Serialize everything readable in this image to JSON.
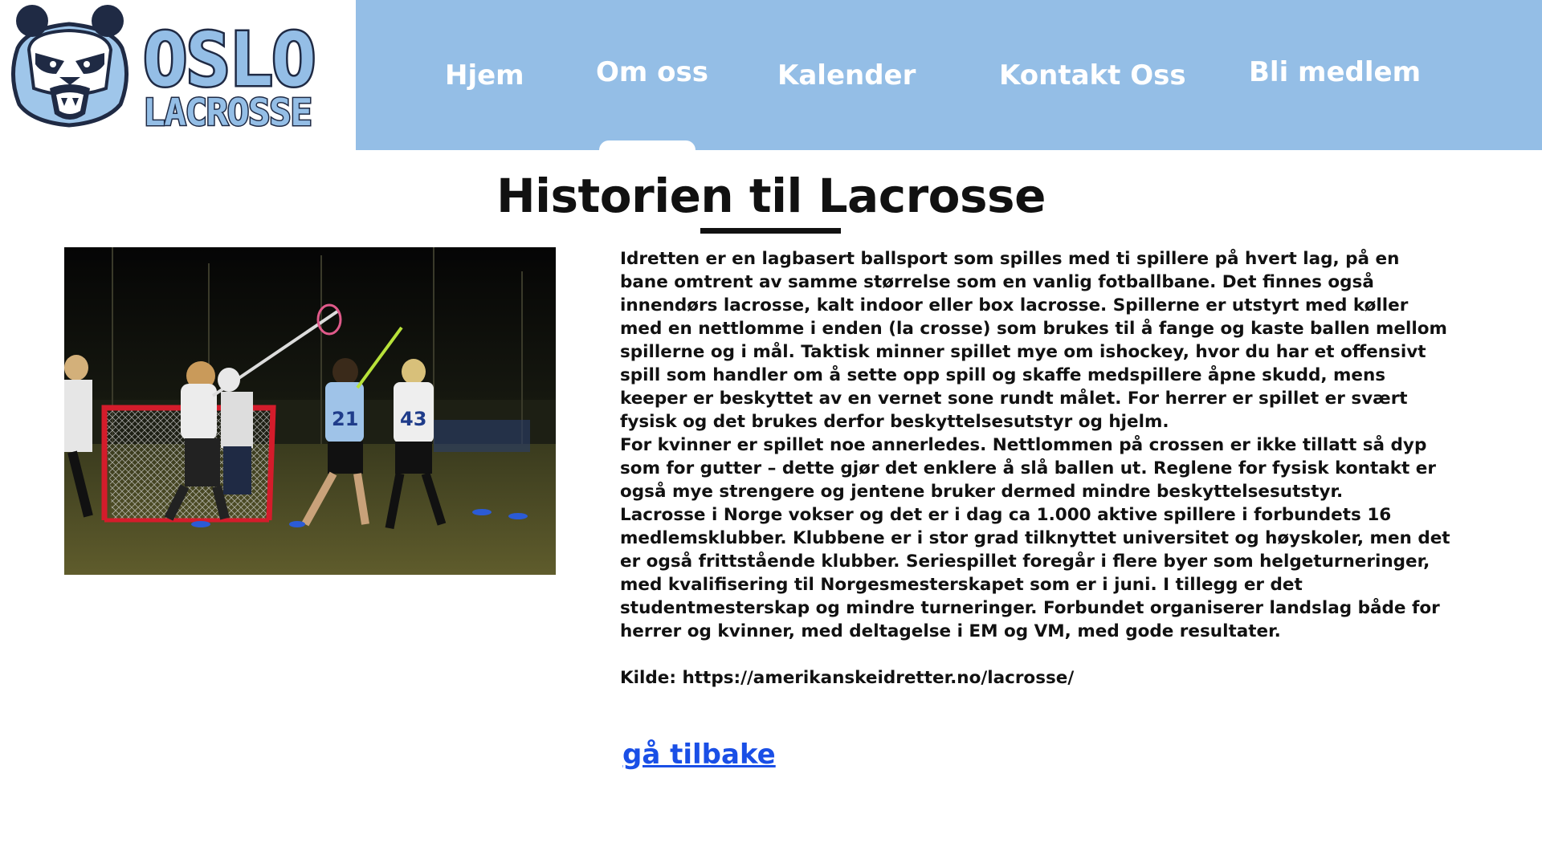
{
  "brand": {
    "logo_line1": "OSLO",
    "logo_line2": "LACROSSE",
    "navy": "#1f2a44",
    "light_blue": "#94bee6"
  },
  "nav": {
    "items": [
      {
        "label": "Hjem",
        "active": false
      },
      {
        "label": "Om oss",
        "active": true
      },
      {
        "label": "Kalender",
        "active": false
      },
      {
        "label": "Kontakt Oss",
        "active": false
      },
      {
        "label": "Bli medlem",
        "active": false
      }
    ],
    "background": "#94bee6"
  },
  "page": {
    "title": "Historien til Lacrosse"
  },
  "photo": {
    "alt": "Lacrosse-spillere på banen om kvelden",
    "jersey_numbers": [
      "21",
      "43"
    ]
  },
  "article": {
    "paragraphs": [
      "Idretten er en lagbasert ballsport som spilles med ti spillere på hvert lag, på en bane omtrent av samme størrelse som en vanlig fotballbane. Det finnes også innendørs lacrosse, kalt indoor eller box lacrosse. Spillerne er utstyrt med køller med en nettlomme i enden (la crosse) som brukes til å fange og kaste ballen mellom spillerne og i mål. Taktisk minner spillet mye om ishockey, hvor du har et offensivt spill som handler om å sette opp spill og skaffe medspillere åpne skudd, mens keeper er beskyttet av en vernet sone rundt målet. For herrer er spillet er svært fysisk og det brukes derfor beskyttelsesutstyr og hjelm.",
      "For kvinner er spillet noe annerledes. Nettlommen på crossen er ikke tillatt så dyp som for gutter – dette gjør det enklere å slå ballen ut. Reglene for fysisk kontakt er også mye strengere og jentene bruker dermed mindre beskyttelsesutstyr.",
      "Lacrosse i Norge vokser og det er i dag ca 1.000 aktive spillere i forbundets 16 medlemsklubber. Klubbene er i stor grad tilknyttet universitet og høyskoler, men det er også frittstående klubber. Seriespillet foregår i flere byer som helgeturneringer, med kvalifisering til Norgesmesterskapet som er i juni. I tillegg er det studentmesterskap og mindre turneringer. Forbundet organiserer landslag både for herrer og kvinner, med deltagelse i EM og VM, med gode resultater."
    ],
    "source": "Kilde: https://amerikanskeidretter.no/lacrosse/"
  },
  "back_link": {
    "label": "gå tilbake",
    "color": "#1a4fe6"
  }
}
